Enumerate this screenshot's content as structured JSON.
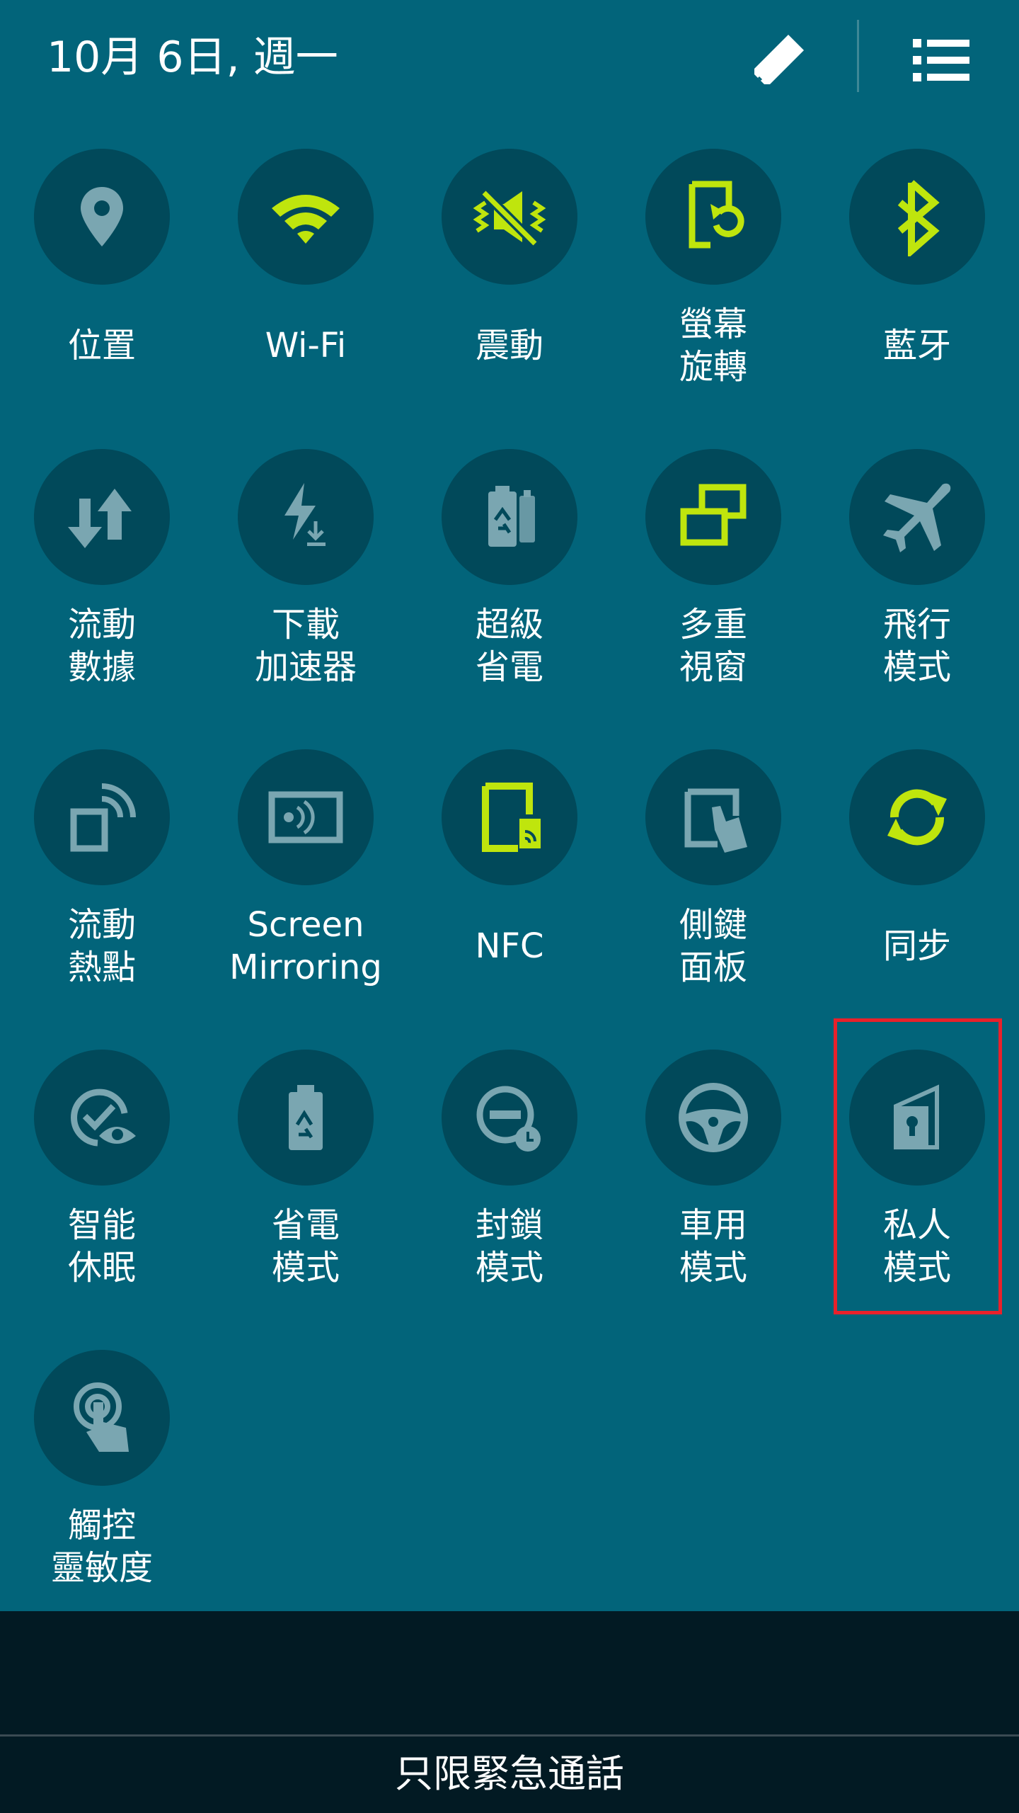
{
  "header": {
    "date": "10月 6日, 週一",
    "edit_icon": "pencil-icon",
    "list_icon": "list-icon"
  },
  "colors": {
    "panel_bg": "#02647a",
    "tile_circle": "#01495a",
    "icon_active": "#bfe50d",
    "icon_inactive": "#7aa6b1",
    "highlight": "#e8212b",
    "bottom_bg": "#021a23"
  },
  "tiles": [
    {
      "label": "位置",
      "icon": "location-pin-icon",
      "state": "off"
    },
    {
      "label": "Wi-Fi",
      "icon": "wifi-icon",
      "state": "on"
    },
    {
      "label": "震動",
      "icon": "vibrate-icon",
      "state": "on"
    },
    {
      "label": "螢幕\n旋轉",
      "icon": "screen-rotation-icon",
      "state": "on"
    },
    {
      "label": "藍牙",
      "icon": "bluetooth-icon",
      "state": "on"
    },
    {
      "label": "流動\n數據",
      "icon": "mobile-data-icon",
      "state": "off"
    },
    {
      "label": "下載\n加速器",
      "icon": "download-booster-icon",
      "state": "off"
    },
    {
      "label": "超級\n省電",
      "icon": "ultra-power-saving-icon",
      "state": "off"
    },
    {
      "label": "多重\n視窗",
      "icon": "multi-window-icon",
      "state": "on"
    },
    {
      "label": "飛行\n模式",
      "icon": "airplane-icon",
      "state": "off"
    },
    {
      "label": "流動\n熱點",
      "icon": "mobile-hotspot-icon",
      "state": "off"
    },
    {
      "label": "Screen\nMirroring",
      "icon": "screen-mirroring-icon",
      "state": "off"
    },
    {
      "label": "NFC",
      "icon": "nfc-icon",
      "state": "on"
    },
    {
      "label": "側鍵\n面板",
      "icon": "side-key-panel-icon",
      "state": "off"
    },
    {
      "label": "同步",
      "icon": "sync-icon",
      "state": "on"
    },
    {
      "label": "智能\n休眠",
      "icon": "smart-stay-icon",
      "state": "off"
    },
    {
      "label": "省電\n模式",
      "icon": "power-saving-icon",
      "state": "off"
    },
    {
      "label": "封鎖\n模式",
      "icon": "blocking-mode-icon",
      "state": "off"
    },
    {
      "label": "車用\n模式",
      "icon": "car-mode-icon",
      "state": "off"
    },
    {
      "label": "私人\n模式",
      "icon": "private-mode-icon",
      "state": "off"
    },
    {
      "label": "觸控\n靈敏度",
      "icon": "touch-sensitivity-icon",
      "state": "off"
    }
  ],
  "footer": {
    "emergency": "只限緊急通話"
  }
}
